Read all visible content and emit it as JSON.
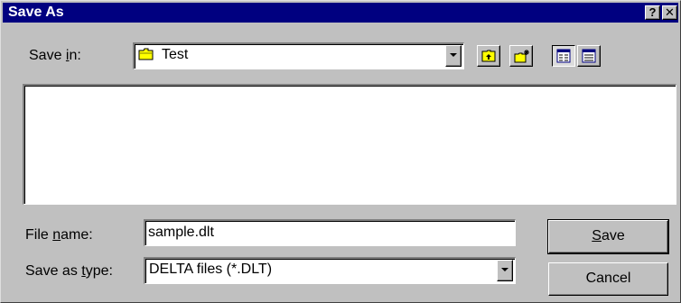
{
  "window": {
    "title": "Save As",
    "help_glyph": "?",
    "close_glyph": "✕"
  },
  "save_in": {
    "label_pre": "Save ",
    "label_key": "i",
    "label_post": "n:",
    "value": "Test",
    "icon": "folder-icon"
  },
  "toolbar": {
    "buttons": [
      {
        "name": "up-one-level",
        "icon": "up-folder-icon"
      },
      {
        "name": "create-new-folder",
        "icon": "new-folder-icon"
      },
      {
        "name": "list-view",
        "icon": "list-view-icon"
      },
      {
        "name": "details-view",
        "icon": "details-view-icon"
      }
    ]
  },
  "file_name": {
    "label_pre": "File ",
    "label_key": "n",
    "label_post": "ame:",
    "value": "sample.dlt"
  },
  "save_type": {
    "label_pre": "Save as ",
    "label_key": "t",
    "label_post": "ype:",
    "value": "DELTA files (*.DLT)"
  },
  "buttons": {
    "save_key": "S",
    "save_rest": "ave",
    "cancel": "Cancel"
  },
  "colors": {
    "titlebar": "#000080",
    "face": "#c0c0c0",
    "folder": "#ffff00"
  }
}
